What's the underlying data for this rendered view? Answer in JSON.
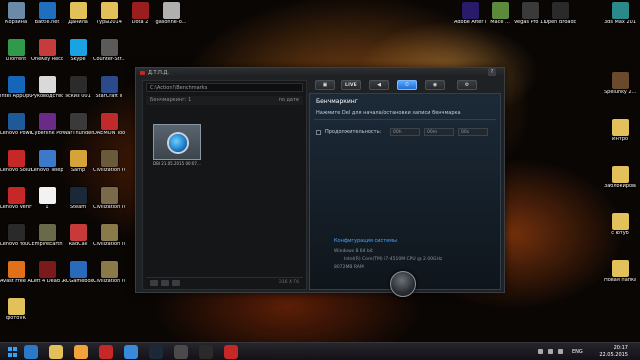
{
  "desktop_icons_left": [
    {
      "label": "Корзина",
      "color": "#6b8aa8"
    },
    {
      "label": "Battle.net",
      "color": "#1f6fbf"
    },
    {
      "label": "Данила",
      "color": "#e2c15a"
    },
    {
      "label": "Туры2014",
      "color": "#e2c15a"
    },
    {
      "label": "Dota 2",
      "color": "#9b1e1e"
    },
    {
      "label": "gasonne-o...",
      "color": "#b0b0b0"
    },
    {
      "label": "uTorrent",
      "color": "#2e9a4a"
    },
    {
      "label": "OneKey Recovery",
      "color": "#c63c3c"
    },
    {
      "label": "Skype",
      "color": "#1aa3e2"
    },
    {
      "label": "Counter-Str... 1.6",
      "color": "#5a5a5a"
    },
    {
      "label": "Intel AppUpC...",
      "color": "#1565b8"
    },
    {
      "label": "Руководство пользова...",
      "color": "#d9d9d9"
    },
    {
      "label": "эскиз 001",
      "color": "#2b2b2b"
    },
    {
      "label": "StarCraft II",
      "color": "#2a4a8a"
    },
    {
      "label": "Lenovo PowerDVD 10",
      "color": "#1e5a9a"
    },
    {
      "label": "Cyberlink PowerDir",
      "color": "#6a2a8a"
    },
    {
      "label": "WarThunder",
      "color": "#3a3a3a"
    },
    {
      "label": "DAEMON Tools Lite",
      "color": "#c02a2a"
    },
    {
      "label": "Lenovo Soluti...",
      "color": "#c62828"
    },
    {
      "label": "Lenovo Telepho...",
      "color": "#3a7ac8"
    },
    {
      "label": "Samp",
      "color": "#d6a23a"
    },
    {
      "label": "Civilization IV - Warlords",
      "color": "#6a5a3a"
    },
    {
      "label": "Lenovo VeriFace",
      "color": "#c62828"
    },
    {
      "label": "1",
      "color": "#f2f2f2"
    },
    {
      "label": "Steam",
      "color": "#1b2838"
    },
    {
      "label": "Civilization IV - Колония...",
      "color": "#7a6a4a"
    },
    {
      "label": "Lenovo YouCam",
      "color": "#2a2a2a"
    },
    {
      "label": "EmpireEarth",
      "color": "#6a6a4a"
    },
    {
      "label": "RadCall",
      "color": "#c63a3a"
    },
    {
      "label": "Civilization IV - Эпоха огня",
      "color": "#8a7a4a"
    },
    {
      "label": "Avast Free Antivirus",
      "color": "#e0701a"
    },
    {
      "label": "Left 4 Dead 2",
      "color": "#7a1a1a"
    },
    {
      "label": "RCGamebox",
      "color": "#2a6aba"
    },
    {
      "label": "Civilization IV",
      "color": "#8a7a4a"
    },
    {
      "label": "фотоVK",
      "color": "#e2c15a"
    }
  ],
  "desktop_icons_top_right": [
    {
      "label": "Adobe After Effects...",
      "color": "#2a1a6a"
    },
    {
      "label": "Mace ...",
      "color": "#5a8a3a"
    },
    {
      "label": "Vegas Pro 13.0 (64-bit)",
      "color": "#3a3a3a"
    },
    {
      "label": "Open Broadcast...",
      "color": "#2a2a2a"
    },
    {
      "label": "3ds Max 2015",
      "color": "#2a8a8a"
    }
  ],
  "desktop_icons_right": [
    {
      "label": "Spelunky 2...",
      "color": "#6a4a2a"
    },
    {
      "label": "Интро",
      "color": "#e2c15a"
    },
    {
      "label": "Заблокирован...",
      "color": "#e2c15a"
    },
    {
      "label": "с ютуб",
      "color": "#e2c15a"
    },
    {
      "label": "Новая папка",
      "color": "#e2c15a"
    }
  ],
  "app": {
    "title": "Д.Т.П.Д.",
    "path": "C:\\Action!\\Benchmarks",
    "list_header": "Бенчмаркинг: 1",
    "sort_label": "по дате",
    "thumb_caption": "DBI 21.05.2015 00:07...",
    "count": "Э16 X Гб",
    "tabs": [
      {
        "label": "▣",
        "name": "tab-video"
      },
      {
        "label": "LIVE",
        "name": "tab-live"
      },
      {
        "label": "◀",
        "name": "tab-audio"
      },
      {
        "label": "⏱",
        "name": "tab-benchmark"
      },
      {
        "label": "◉",
        "name": "tab-screenshot"
      },
      {
        "label": "⚙",
        "name": "tab-settings"
      }
    ],
    "panel": {
      "title": "Бенчмаркинг",
      "hint": "Нажмите Del для начала/остановки записи бенчмарка",
      "duration_label": "Продолжительность:",
      "duration_options": [
        "00h",
        "00m",
        "00s"
      ],
      "config_link": "Конфигурация системы",
      "sys_lines": [
        "Windows 8 64 bit",
        "Intel(R) Core(TM) i7-4510M CPU @ 2.00GHz",
        "8072MB RAM"
      ]
    }
  },
  "taskbar": {
    "lang": "ENG",
    "time": "20:17",
    "date": "22.05.2015",
    "apps": [
      "#2a7ac8",
      "#e2c15a",
      "#f2a23a",
      "#c62828",
      "#3a8adb",
      "#1b2838",
      "#4a4a4a",
      "#2a2a2a",
      "#c62828"
    ]
  }
}
